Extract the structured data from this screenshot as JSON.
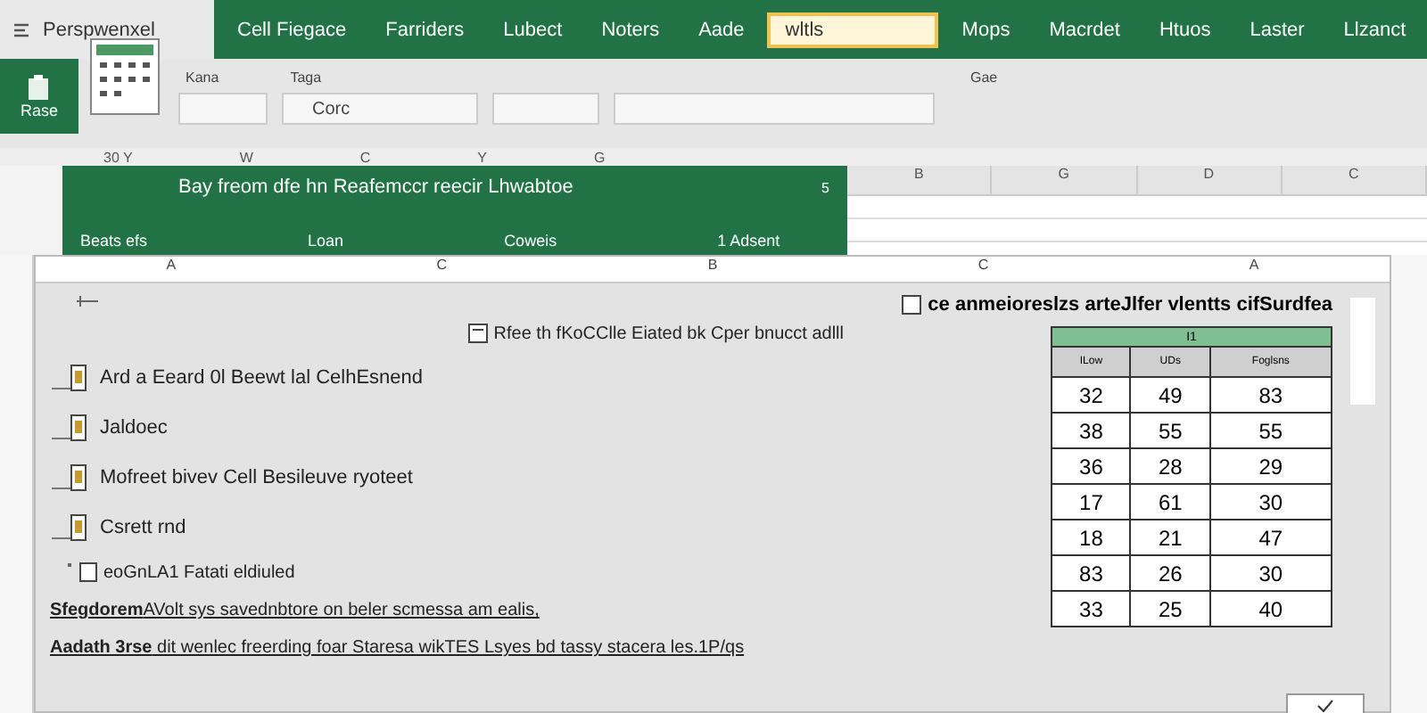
{
  "ribbon": {
    "file_tab": "Perspwenxel",
    "tabs": [
      {
        "label": "Cell Fiegace",
        "selected": false
      },
      {
        "label": "Farriders",
        "selected": false
      },
      {
        "label": "Lubect",
        "selected": false
      },
      {
        "label": "Noters",
        "selected": false
      },
      {
        "label": "Aade",
        "selected": false
      },
      {
        "label": "wltls",
        "selected": true
      },
      {
        "label": "Mops",
        "selected": false
      },
      {
        "label": "Macrdet",
        "selected": false
      },
      {
        "label": "Htuos",
        "selected": false
      },
      {
        "label": "Laster",
        "selected": false
      },
      {
        "label": "Llzanct",
        "selected": false
      }
    ],
    "paste_label": "Rase",
    "group_labels": [
      "Kana",
      "Taga",
      "Gae"
    ],
    "font_field": {
      "value": "Corc"
    },
    "column_letters": [
      "30 Y",
      "W",
      "C",
      "Y",
      "G"
    ]
  },
  "banner": {
    "number": "5",
    "title": "Bay freom dfe hn Reafemccr reecir Lhwabtoe",
    "items": [
      "Beats efs",
      "Loan",
      "Coweis",
      "1 Adsent"
    ]
  },
  "sheet_columns": [
    "B",
    "G",
    "D",
    "C"
  ],
  "dialog": {
    "columns": [
      "A",
      "C",
      "B",
      "C",
      "A"
    ],
    "heading": "Rfee th fKoCClle Eiated bk Cper bnucct adlll",
    "options": [
      {
        "kind": "icon",
        "text": "Ard a Eeard 0l Beewt lal CelhEsnend"
      },
      {
        "kind": "icon",
        "text": "Jaldoec"
      },
      {
        "kind": "icon",
        "text": "Mofreet bivev Cell Besileuve ryoteet"
      },
      {
        "kind": "icon",
        "text": "Csrett rnd"
      },
      {
        "kind": "small",
        "text": "eoGnLA1 Fatati eldiuled"
      }
    ],
    "notes": [
      "**Sfegdorem**AVolt sys savednbtore on beler scmessa am ealis,",
      "**Aadath 3rse** dit wenlec freerding foar Staresa wikTES Lsyes bd tassy stacera les.1P/qs"
    ],
    "side_title": "ce anmeioreslzs arteJlfer vlentts cifSurdfea",
    "table": {
      "caption": "I1",
      "columns": [
        "ILow",
        "UDs",
        "Foglsns"
      ],
      "rows": [
        [
          "32",
          "49",
          "83"
        ],
        [
          "38",
          "55",
          "55"
        ],
        [
          "36",
          "28",
          "29"
        ],
        [
          "17",
          "61",
          "30"
        ],
        [
          "18",
          "21",
          "47"
        ],
        [
          "83",
          "26",
          "30"
        ],
        [
          "33",
          "25",
          "40"
        ]
      ]
    }
  }
}
